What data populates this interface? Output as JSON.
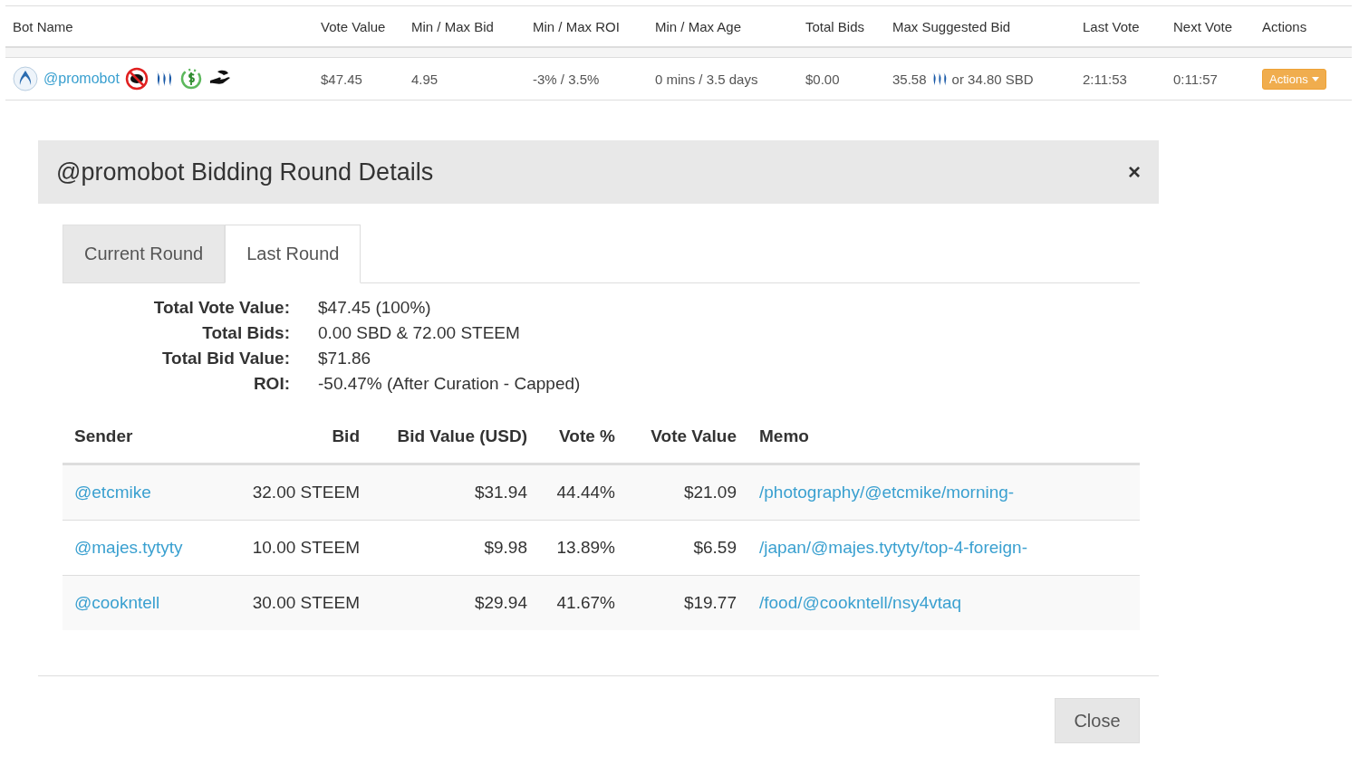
{
  "bots_table": {
    "columns": [
      "Bot Name",
      "Vote Value",
      "Min / Max Bid",
      "Min / Max ROI",
      "Min / Max Age",
      "Total Bids",
      "Max Suggested Bid",
      "Last Vote",
      "Next Vote",
      "Actions"
    ],
    "row": {
      "name": "@promobot",
      "vote_value": "$47.45",
      "min_max_bid": "4.95",
      "min_max_roi": "-3% / 3.5%",
      "min_max_age": "0 mins / 3.5 days",
      "total_bids": "$0.00",
      "max_suggested_amount": "35.58",
      "max_suggested_rest": "or 34.80 SBD",
      "last_vote": "2:11:53",
      "next_vote": "0:11:57",
      "actions_button": "Actions"
    }
  },
  "modal": {
    "title": "@promobot Bidding Round Details",
    "close_icon": "×",
    "tabs": [
      {
        "label": "Current Round",
        "selected": false
      },
      {
        "label": "Last Round",
        "selected": true
      }
    ],
    "summary": [
      {
        "label": "Total Vote Value:",
        "value": "$47.45 (100%)"
      },
      {
        "label": "Total Bids:",
        "value": "0.00 SBD & 72.00 STEEM"
      },
      {
        "label": "Total Bid Value:",
        "value": "$71.86"
      },
      {
        "label": "ROI:",
        "value": "-50.47% (After Curation - Capped)"
      }
    ],
    "bids_table": {
      "columns": [
        "Sender",
        "Bid",
        "Bid Value (USD)",
        "Vote %",
        "Vote Value",
        "Memo"
      ],
      "rows": [
        {
          "sender": "@etcmike",
          "bid": "32.00 STEEM",
          "bid_value": "$31.94",
          "vote_pct": "44.44%",
          "vote_value": "$21.09",
          "memo": "/photography/@etcmike/morning-"
        },
        {
          "sender": "@majes.tytyty",
          "bid": "10.00 STEEM",
          "bid_value": "$9.98",
          "vote_pct": "13.89%",
          "vote_value": "$6.59",
          "memo": "/japan/@majes.tytyty/top-4-foreign-"
        },
        {
          "sender": "@cookntell",
          "bid": "30.00 STEEM",
          "bid_value": "$29.94",
          "vote_pct": "41.67%",
          "vote_value": "$19.77",
          "memo": "/food/@cookntell/nsy4vtaq"
        }
      ]
    },
    "close_button": "Close"
  }
}
